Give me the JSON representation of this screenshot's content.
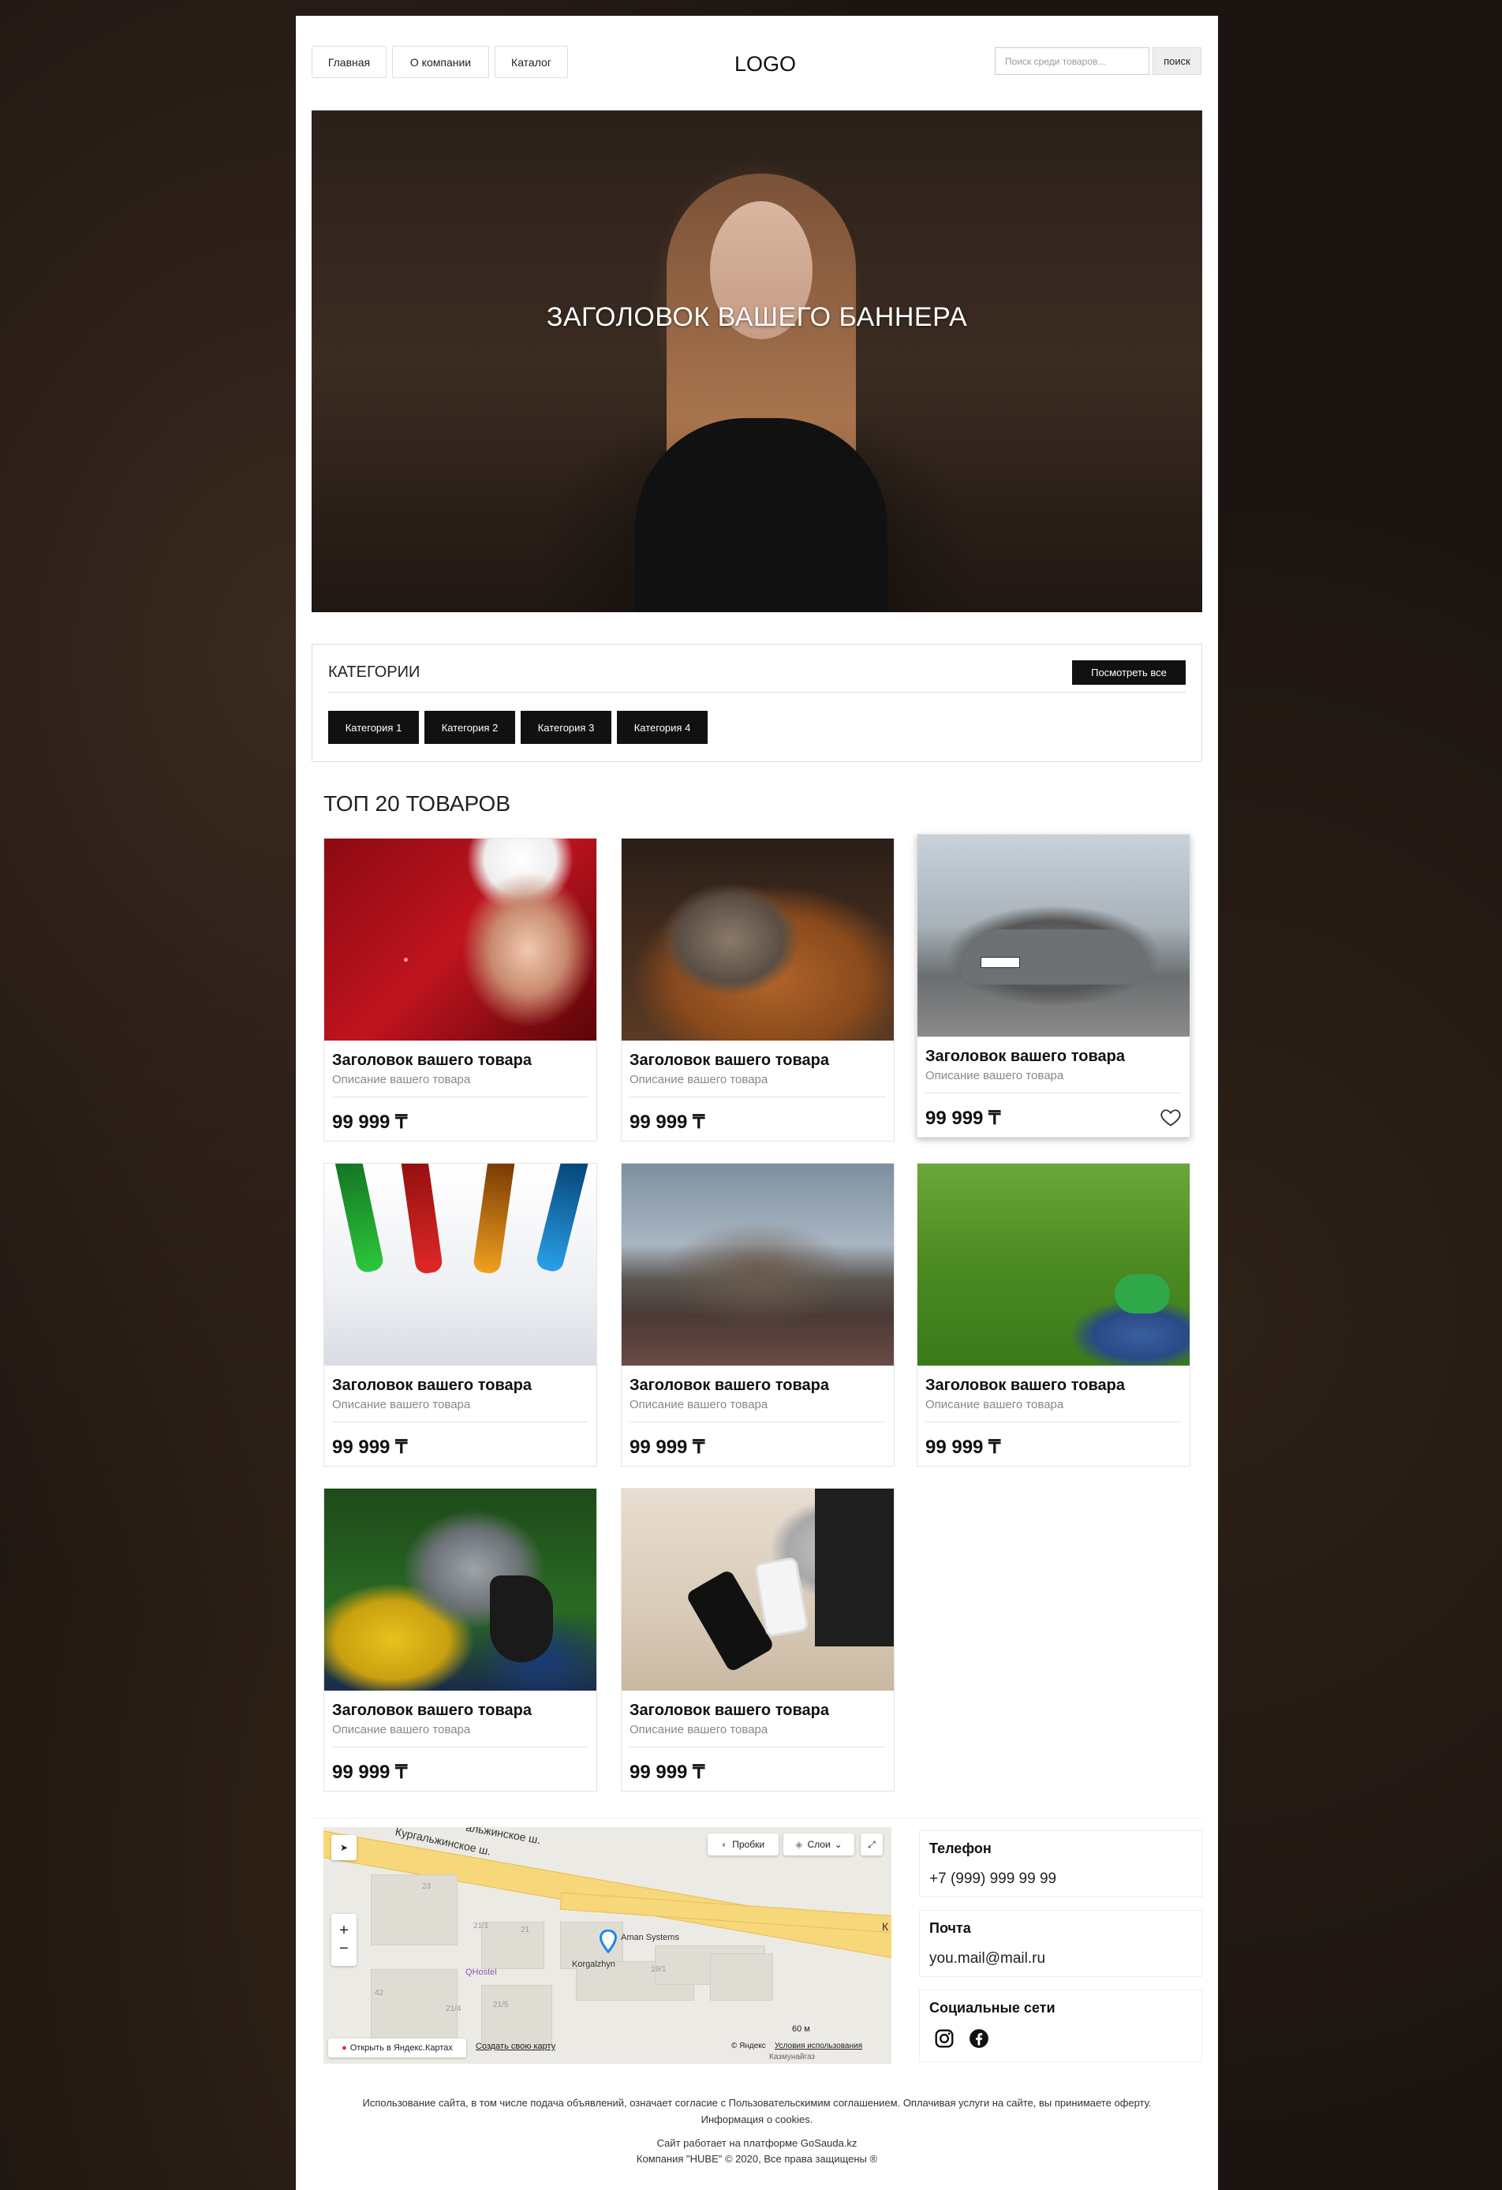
{
  "header": {
    "nav": [
      "Главная",
      "О компании",
      "Каталог"
    ],
    "logo": "LOGO",
    "search_placeholder": "Поиск среди товаров...",
    "search_button": "поиск"
  },
  "banner": {
    "title": "ЗАГОЛОВОК ВАШЕГО БАННЕРА"
  },
  "categories": {
    "title": "КАТЕГОРИИ",
    "view_all": "Посмотреть все",
    "items": [
      "Категория 1",
      "Категория 2",
      "Категория 3",
      "Категория 4"
    ]
  },
  "top": {
    "title": "ТОП 20 ТОВАРОВ",
    "products": [
      {
        "title": "Заголовок вашего товара",
        "desc": "Описание вашего товара",
        "price": "99 999 ₸",
        "image": "woman-winter-hood"
      },
      {
        "title": "Заголовок вашего товара",
        "desc": "Описание вашего товара",
        "price": "99 999 ₸",
        "image": "cat-and-dog"
      },
      {
        "title": "Заголовок вашего товара",
        "desc": "Описание вашего товара",
        "price": "99 999 ₸",
        "image": "grey-car"
      },
      {
        "title": "Заголовок вашего товара",
        "desc": "Описание вашего товара",
        "price": "99 999 ₸",
        "image": "paint-bottles"
      },
      {
        "title": "Заголовок вашего товара",
        "desc": "Описание вашего товара",
        "price": "99 999 ₸",
        "image": "sprinter-cheetahs"
      },
      {
        "title": "Заголовок вашего товара",
        "desc": "Описание вашего товара",
        "price": "99 999 ₸",
        "image": "sneakers-on-grass"
      },
      {
        "title": "Заголовок вашего товара",
        "desc": "Описание вашего товара",
        "price": "99 999 ₸",
        "image": "macaw-parrot"
      },
      {
        "title": "Заголовок вашего товара",
        "desc": "Описание вашего товара",
        "price": "99 999 ₸",
        "image": "desk-laptop-phone"
      }
    ]
  },
  "map": {
    "traffic": "Пробки",
    "layers": "Слои",
    "place": "Aman Systems",
    "labels": [
      "Кургальжинское ш.",
      "альжинское ш.",
      "Korgalzhyn",
      "QHostel",
      "23",
      "21",
      "21/1",
      "19/1",
      "21/4",
      "21/5",
      "42",
      "К"
    ],
    "scale": "60 м",
    "open": "Открыть в Яндекс.Картах",
    "create": "Создать свою карту",
    "copyright": "© Яндекс",
    "terms": "Условия использования",
    "bottom_label": "Казмунайгаз"
  },
  "contacts": {
    "phone_label": "Телефон",
    "phone": "+7 (999) 999 99 99",
    "email_label": "Почта",
    "email": "you.mail@mail.ru",
    "social_label": "Социальные сети"
  },
  "footer": {
    "line1": "Использование сайта, в том числе подача объявлений, означает согласие с Пользовательскимим соглашением. Оплачивая услуги на сайте, вы принимаете оферту.",
    "line2": "Информация о cookies.",
    "line3": "Сайт работает на платформе GoSauda.kz",
    "line4": "Компания \"HUBE\" © 2020, Все права защищены ®"
  }
}
